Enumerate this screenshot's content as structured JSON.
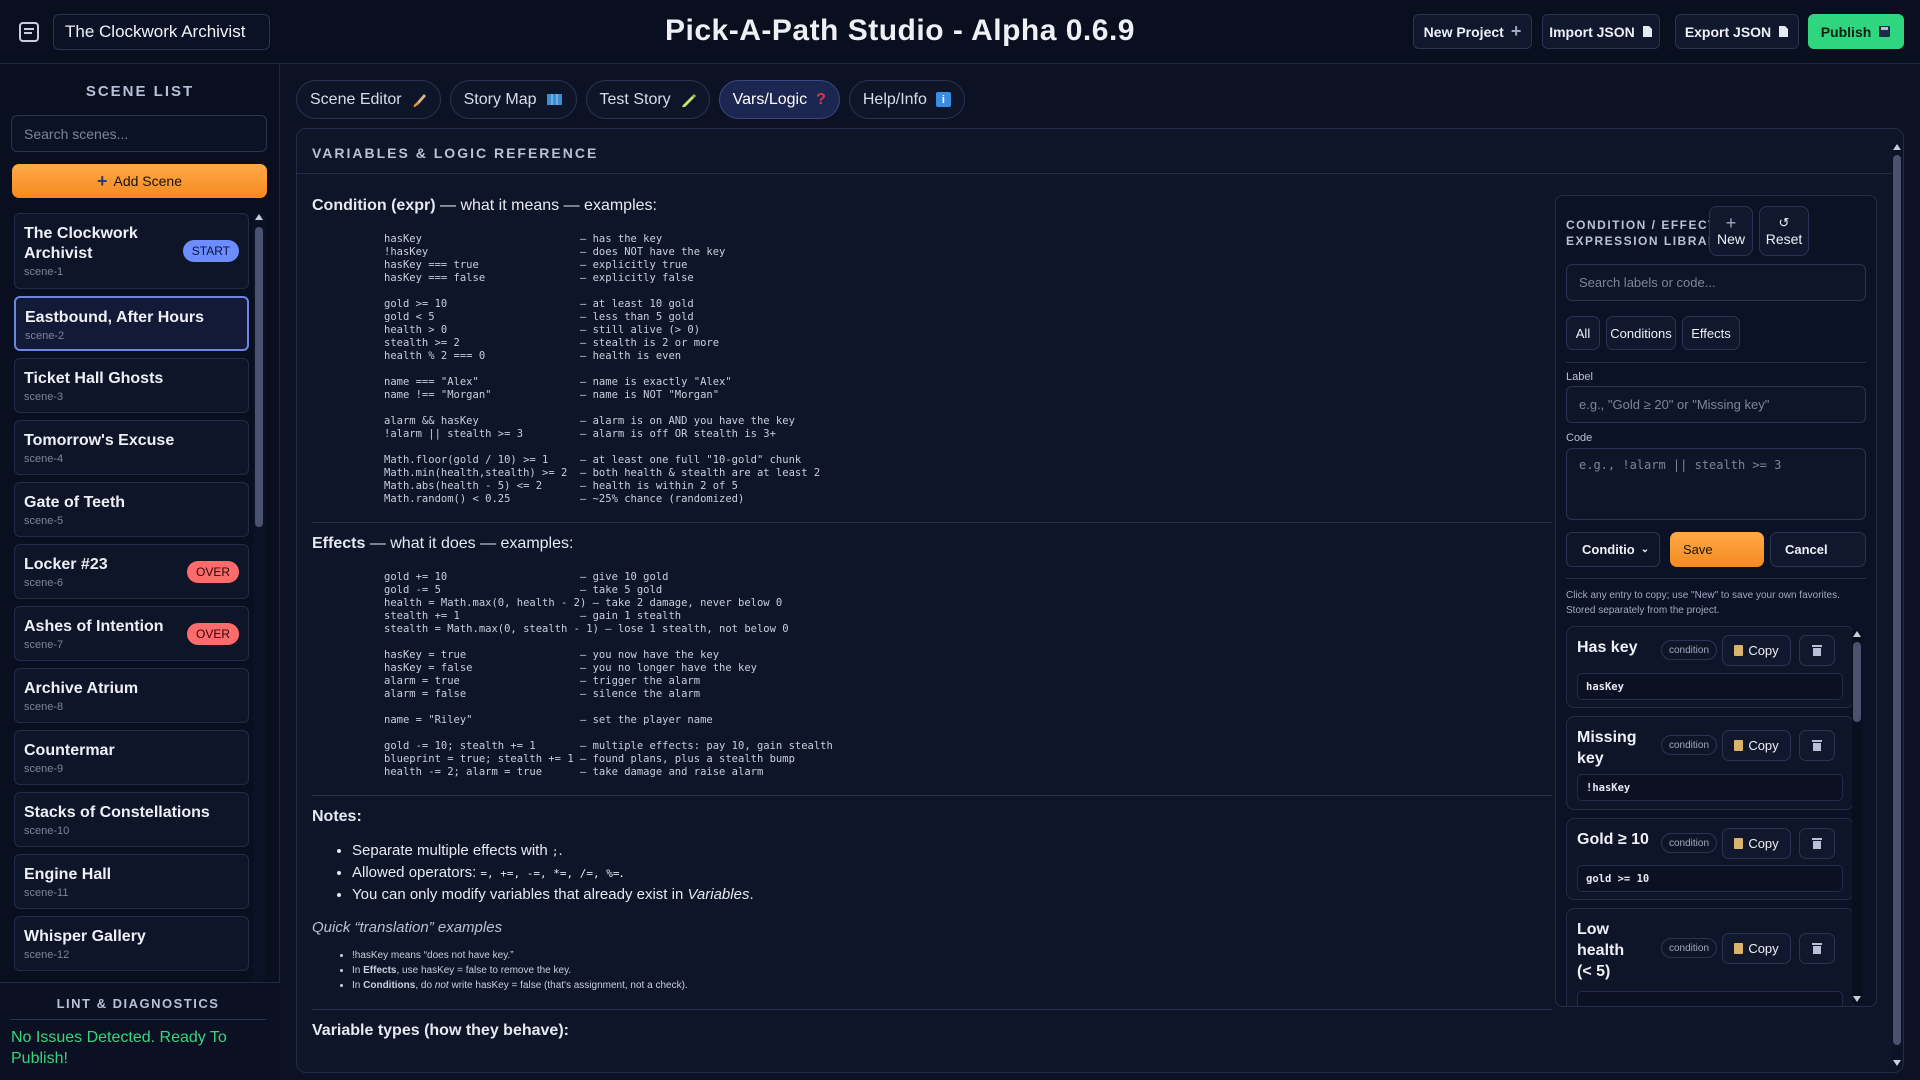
{
  "header": {
    "project_name": "The Clockwork Archivist",
    "app_title": "Pick-A-Path Studio - Alpha 0.6.9",
    "buttons": {
      "new_project": "New Project",
      "import_json": "Import JSON",
      "export_json": "Export JSON",
      "publish": "Publish"
    }
  },
  "sidebar": {
    "heading": "SCENE LIST",
    "search_placeholder": "Search scenes...",
    "add_scene": "Add Scene",
    "scenes": [
      {
        "title": "The Clockwork Archivist",
        "id": "scene-1",
        "badge": "START"
      },
      {
        "title": "Eastbound, After Hours",
        "id": "scene-2"
      },
      {
        "title": "Ticket Hall Ghosts",
        "id": "scene-3"
      },
      {
        "title": "Tomorrow's Excuse",
        "id": "scene-4"
      },
      {
        "title": "Gate of Teeth",
        "id": "scene-5"
      },
      {
        "title": "Locker #23",
        "id": "scene-6",
        "badge": "OVER"
      },
      {
        "title": "Ashes of Intention",
        "id": "scene-7",
        "badge": "OVER"
      },
      {
        "title": "Archive Atrium",
        "id": "scene-8"
      },
      {
        "title": "Countermar",
        "id": "scene-9"
      },
      {
        "title": "Stacks of Constellations",
        "id": "scene-10"
      },
      {
        "title": "Engine Hall",
        "id": "scene-11"
      },
      {
        "title": "Whisper Gallery",
        "id": "scene-12"
      }
    ],
    "active_scene": "scene-2",
    "lint": {
      "heading": "LINT & DIAGNOSTICS",
      "message": "No Issues Detected. Ready To Publish!",
      "status_color": "#36d67f"
    }
  },
  "tabs": [
    {
      "label": "Scene Editor",
      "icon": "brush-icon"
    },
    {
      "label": "Story Map",
      "icon": "map-icon"
    },
    {
      "label": "Test Story",
      "icon": "pencil-icon"
    },
    {
      "label": "Vars/Logic",
      "icon": "question-icon",
      "active": true
    },
    {
      "label": "Help/Info",
      "icon": "info-icon"
    }
  ],
  "reference": {
    "heading": "VARIABLES & LOGIC REFERENCE",
    "condition_title": "Condition (expr)",
    "condition_suffix": " — what it means — examples:",
    "condition_code": "hasKey                         — has the key\n!hasKey                        — does NOT have the key\nhasKey === true                — explicitly true\nhasKey === false               — explicitly false\n\ngold >= 10                     — at least 10 gold\ngold < 5                       — less than 5 gold\nhealth > 0                     — still alive (> 0)\nstealth >= 2                   — stealth is 2 or more\nhealth % 2 === 0               — health is even\n\nname === \"Alex\"                — name is exactly \"Alex\"\nname !== \"Morgan\"              — name is NOT \"Morgan\"\n\nalarm && hasKey                — alarm is on AND you have the key\n!alarm || stealth >= 3         — alarm is off OR stealth is 3+\n\nMath.floor(gold / 10) >= 1     — at least one full \"10-gold\" chunk\nMath.min(health,stealth) >= 2  — both health & stealth are at least 2\nMath.abs(health - 5) <= 2      — health is within 2 of 5\nMath.random() < 0.25           — ~25% chance (randomized)",
    "effects_title": "Effects",
    "effects_suffix": " — what it does — examples:",
    "effects_code": "gold += 10                     — give 10 gold\ngold -= 5                      — take 5 gold\nhealth = Math.max(0, health - 2) — take 2 damage, never below 0\nstealth += 1                   — gain 1 stealth\nstealth = Math.max(0, stealth - 1) — lose 1 stealth, not below 0\n\nhasKey = true                  — you now have the key\nhasKey = false                 — you no longer have the key\nalarm = true                   — trigger the alarm\nalarm = false                  — silence the alarm\n\nname = \"Riley\"                 — set the player name\n\ngold -= 10; stealth += 1       — multiple effects: pay 10, gain stealth\nblueprint = true; stealth += 1 — found plans, plus a stealth bump\nhealth -= 2; alarm = true      — take damage and raise alarm",
    "notes_title": "Notes:",
    "notes": {
      "n1_text": "Separate multiple effects with ",
      "n1_code": ";",
      "n1_end": ".",
      "n2_text": "Allowed operators: ",
      "n2_code": "=, +=, -=, *=, /=, %=",
      "n2_end": ".",
      "n3_text": "You can only modify variables that already exist in ",
      "n3_em": "Variables",
      "n3_end": "."
    },
    "quick_title": "Quick “translation” examples",
    "quick": {
      "q1": "!hasKey means “does not have key.”",
      "q2_a": "In ",
      "q2_b": "Effects",
      "q2_c": ", use hasKey = false to remove the key.",
      "q3_a": "In ",
      "q3_b": "Conditions",
      "q3_c": ", do ",
      "q3_d": "not",
      "q3_e": " write hasKey = false (that's assignment, not a check)."
    },
    "types_title": "Variable types (how they behave):"
  },
  "library": {
    "heading_line1": "CONDITION / EFFECT",
    "heading_line2": "EXPRESSION LIBRARY",
    "new_label": "New",
    "reset_label": "Reset",
    "search_placeholder": "Search labels or code...",
    "filters": [
      "All",
      "Conditions",
      "Effects"
    ],
    "label_caption": "Label",
    "label_placeholder": "e.g., \"Gold ≥ 20\" or \"Missing key\"",
    "code_caption": "Code",
    "code_placeholder": "e.g., !alarm || stealth >= 3",
    "type_select": "Conditio",
    "save_label": "Save",
    "cancel_label": "Cancel",
    "hint": "Click any entry to copy; use \"New\" to save your own favorites. Stored separately from the project.",
    "copy_label": "Copy",
    "entries": [
      {
        "title": "Has key",
        "kind": "condition",
        "code": "hasKey"
      },
      {
        "title": "Missing key",
        "kind": "condition",
        "code": "!hasKey"
      },
      {
        "title": "Gold ≥ 10",
        "kind": "condition",
        "code": "gold >= 10"
      },
      {
        "title": "Low health (< 5)",
        "kind": "condition",
        "code": ""
      }
    ]
  }
}
